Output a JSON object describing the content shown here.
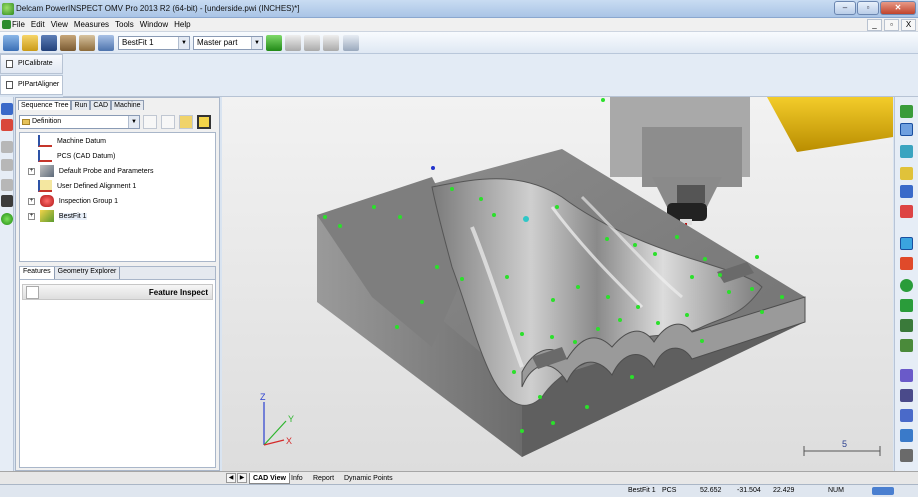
{
  "window": {
    "title": "Delcam PowerINSPECT OMV Pro 2013 R2 (64-bit) - [underside.pwi (INCHES)*]",
    "controls": [
      "–",
      "▫",
      "✕"
    ]
  },
  "menu": {
    "items": [
      "File",
      "Edit",
      "View",
      "Measures",
      "Tools",
      "Window",
      "Help"
    ],
    "mdi_controls": [
      "_",
      "▫",
      "X"
    ]
  },
  "toolbar": {
    "alignment_select": "BestFit 1",
    "cad_select": "Master part"
  },
  "plugins": {
    "tabs": [
      "PICalibrate",
      "PIPartAligner"
    ]
  },
  "sequence_panel": {
    "tabs": [
      "Sequence Tree",
      "Run",
      "CAD",
      "Machine"
    ],
    "view_select": "Definition",
    "tree": [
      {
        "label": "Machine Datum",
        "expander": "",
        "icon": "datum"
      },
      {
        "label": "PCS (CAD Datum)",
        "expander": "",
        "icon": "datum"
      },
      {
        "label": "Default Probe and Parameters",
        "expander": "+",
        "icon": "probe"
      },
      {
        "label": "User Defined Alignment 1",
        "expander": "",
        "icon": "align"
      },
      {
        "label": "Inspection Group 1",
        "expander": "+",
        "icon": "group"
      },
      {
        "label": "BestFit 1",
        "expander": "+",
        "icon": "bestfit"
      }
    ]
  },
  "feature_panel": {
    "tabs": [
      "Features",
      "Geometry Explorer"
    ],
    "title": "Feature Inspect"
  },
  "viewport": {
    "axis_labels": {
      "x": "X",
      "y": "Y",
      "z": "Z"
    },
    "scale_label": "5"
  },
  "view_tabs": {
    "tabs": [
      "CAD View",
      "Info",
      "Report",
      "Dynamic Points"
    ],
    "active": "CAD View"
  },
  "status": {
    "alignment": "BestFit 1",
    "coordinate_system": "PCS",
    "x": "52.652",
    "y": "-31.504",
    "z": "22.429",
    "num": "NUM"
  },
  "colors": {
    "point_green": "#2be02b",
    "part_gray": "#8c8c8c",
    "head_yellow": "#e6b800"
  }
}
